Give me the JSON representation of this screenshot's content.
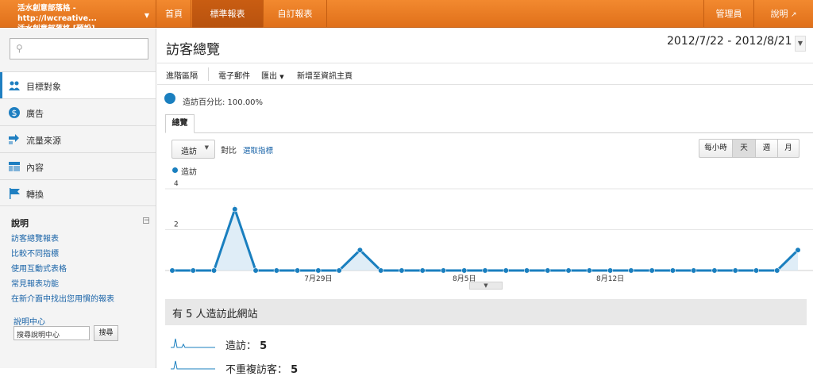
{
  "account": {
    "line1": "活水創意部落格 - http://lwcreative...",
    "line2": "活水創意部落格 [預設]"
  },
  "nav": {
    "home": "首頁",
    "standard": "標準報表",
    "custom": "自訂報表",
    "admin": "管理員",
    "help": "說明"
  },
  "sidebar": {
    "items": [
      {
        "label": "目標對象",
        "icon": "users-icon"
      },
      {
        "label": "廣告",
        "icon": "dollar-icon"
      },
      {
        "label": "流量來源",
        "icon": "arrows-icon"
      },
      {
        "label": "內容",
        "icon": "layout-icon"
      },
      {
        "label": "轉換",
        "icon": "flag-icon"
      }
    ],
    "help_title": "說明",
    "help_links": [
      "訪客總覽報表",
      "比較不同指標",
      "使用互動式表格",
      "常見報表功能",
      "在新介面中找出您用慣的報表"
    ],
    "help_center_label": "說明中心",
    "help_center_placeholder": "搜尋說明中心",
    "search_button": "搜尋"
  },
  "main": {
    "title": "訪客總覽",
    "date_range": "2012/7/22 - 2012/8/21",
    "toolbar": [
      "進階區隔",
      "電子郵件",
      "匯出",
      "新增至資訊主頁"
    ],
    "percent": "造訪百分比: 100.00%",
    "tab": "總覽",
    "metric": "造訪",
    "vs": "對比",
    "pick": "選取指標",
    "periods": [
      "每小時",
      "天",
      "週",
      "月"
    ],
    "active_period": "天",
    "summary": "有 5 人造訪此網站",
    "stats": [
      {
        "label": "造訪：",
        "value": "5"
      },
      {
        "label": "不重複訪客：",
        "value": "5"
      }
    ]
  },
  "chart_data": {
    "type": "area",
    "series": [
      {
        "name": "造訪",
        "values": [
          0,
          0,
          0,
          3,
          0,
          0,
          0,
          0,
          0,
          1,
          0,
          0,
          0,
          0,
          0,
          0,
          0,
          0,
          0,
          0,
          0,
          0,
          0,
          0,
          0,
          0,
          0,
          0,
          0,
          0,
          1
        ]
      }
    ],
    "ylim": [
      0,
      4
    ],
    "yticks": [
      "4",
      "2"
    ],
    "xtick_labels": [
      {
        "label": "7月29日",
        "index": 7
      },
      {
        "label": "8月5日",
        "index": 14
      },
      {
        "label": "8月12日",
        "index": 21
      }
    ],
    "color": "#1a7fbf"
  }
}
